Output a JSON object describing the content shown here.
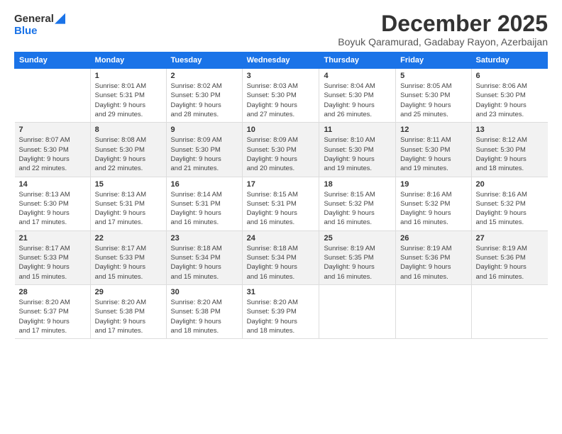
{
  "header": {
    "logo_line1": "General",
    "logo_line2": "Blue",
    "month": "December 2025",
    "location": "Boyuk Qaramurad, Gadabay Rayon, Azerbaijan"
  },
  "weekdays": [
    "Sunday",
    "Monday",
    "Tuesday",
    "Wednesday",
    "Thursday",
    "Friday",
    "Saturday"
  ],
  "weeks": [
    [
      {
        "day": "",
        "info": ""
      },
      {
        "day": "1",
        "info": "Sunrise: 8:01 AM\nSunset: 5:31 PM\nDaylight: 9 hours\nand 29 minutes."
      },
      {
        "day": "2",
        "info": "Sunrise: 8:02 AM\nSunset: 5:30 PM\nDaylight: 9 hours\nand 28 minutes."
      },
      {
        "day": "3",
        "info": "Sunrise: 8:03 AM\nSunset: 5:30 PM\nDaylight: 9 hours\nand 27 minutes."
      },
      {
        "day": "4",
        "info": "Sunrise: 8:04 AM\nSunset: 5:30 PM\nDaylight: 9 hours\nand 26 minutes."
      },
      {
        "day": "5",
        "info": "Sunrise: 8:05 AM\nSunset: 5:30 PM\nDaylight: 9 hours\nand 25 minutes."
      },
      {
        "day": "6",
        "info": "Sunrise: 8:06 AM\nSunset: 5:30 PM\nDaylight: 9 hours\nand 23 minutes."
      }
    ],
    [
      {
        "day": "7",
        "info": "Sunrise: 8:07 AM\nSunset: 5:30 PM\nDaylight: 9 hours\nand 22 minutes."
      },
      {
        "day": "8",
        "info": "Sunrise: 8:08 AM\nSunset: 5:30 PM\nDaylight: 9 hours\nand 22 minutes."
      },
      {
        "day": "9",
        "info": "Sunrise: 8:09 AM\nSunset: 5:30 PM\nDaylight: 9 hours\nand 21 minutes."
      },
      {
        "day": "10",
        "info": "Sunrise: 8:09 AM\nSunset: 5:30 PM\nDaylight: 9 hours\nand 20 minutes."
      },
      {
        "day": "11",
        "info": "Sunrise: 8:10 AM\nSunset: 5:30 PM\nDaylight: 9 hours\nand 19 minutes."
      },
      {
        "day": "12",
        "info": "Sunrise: 8:11 AM\nSunset: 5:30 PM\nDaylight: 9 hours\nand 19 minutes."
      },
      {
        "day": "13",
        "info": "Sunrise: 8:12 AM\nSunset: 5:30 PM\nDaylight: 9 hours\nand 18 minutes."
      }
    ],
    [
      {
        "day": "14",
        "info": "Sunrise: 8:13 AM\nSunset: 5:30 PM\nDaylight: 9 hours\nand 17 minutes."
      },
      {
        "day": "15",
        "info": "Sunrise: 8:13 AM\nSunset: 5:31 PM\nDaylight: 9 hours\nand 17 minutes."
      },
      {
        "day": "16",
        "info": "Sunrise: 8:14 AM\nSunset: 5:31 PM\nDaylight: 9 hours\nand 16 minutes."
      },
      {
        "day": "17",
        "info": "Sunrise: 8:15 AM\nSunset: 5:31 PM\nDaylight: 9 hours\nand 16 minutes."
      },
      {
        "day": "18",
        "info": "Sunrise: 8:15 AM\nSunset: 5:32 PM\nDaylight: 9 hours\nand 16 minutes."
      },
      {
        "day": "19",
        "info": "Sunrise: 8:16 AM\nSunset: 5:32 PM\nDaylight: 9 hours\nand 16 minutes."
      },
      {
        "day": "20",
        "info": "Sunrise: 8:16 AM\nSunset: 5:32 PM\nDaylight: 9 hours\nand 15 minutes."
      }
    ],
    [
      {
        "day": "21",
        "info": "Sunrise: 8:17 AM\nSunset: 5:33 PM\nDaylight: 9 hours\nand 15 minutes."
      },
      {
        "day": "22",
        "info": "Sunrise: 8:17 AM\nSunset: 5:33 PM\nDaylight: 9 hours\nand 15 minutes."
      },
      {
        "day": "23",
        "info": "Sunrise: 8:18 AM\nSunset: 5:34 PM\nDaylight: 9 hours\nand 15 minutes."
      },
      {
        "day": "24",
        "info": "Sunrise: 8:18 AM\nSunset: 5:34 PM\nDaylight: 9 hours\nand 16 minutes."
      },
      {
        "day": "25",
        "info": "Sunrise: 8:19 AM\nSunset: 5:35 PM\nDaylight: 9 hours\nand 16 minutes."
      },
      {
        "day": "26",
        "info": "Sunrise: 8:19 AM\nSunset: 5:36 PM\nDaylight: 9 hours\nand 16 minutes."
      },
      {
        "day": "27",
        "info": "Sunrise: 8:19 AM\nSunset: 5:36 PM\nDaylight: 9 hours\nand 16 minutes."
      }
    ],
    [
      {
        "day": "28",
        "info": "Sunrise: 8:20 AM\nSunset: 5:37 PM\nDaylight: 9 hours\nand 17 minutes."
      },
      {
        "day": "29",
        "info": "Sunrise: 8:20 AM\nSunset: 5:38 PM\nDaylight: 9 hours\nand 17 minutes."
      },
      {
        "day": "30",
        "info": "Sunrise: 8:20 AM\nSunset: 5:38 PM\nDaylight: 9 hours\nand 18 minutes."
      },
      {
        "day": "31",
        "info": "Sunrise: 8:20 AM\nSunset: 5:39 PM\nDaylight: 9 hours\nand 18 minutes."
      },
      {
        "day": "",
        "info": ""
      },
      {
        "day": "",
        "info": ""
      },
      {
        "day": "",
        "info": ""
      }
    ]
  ]
}
